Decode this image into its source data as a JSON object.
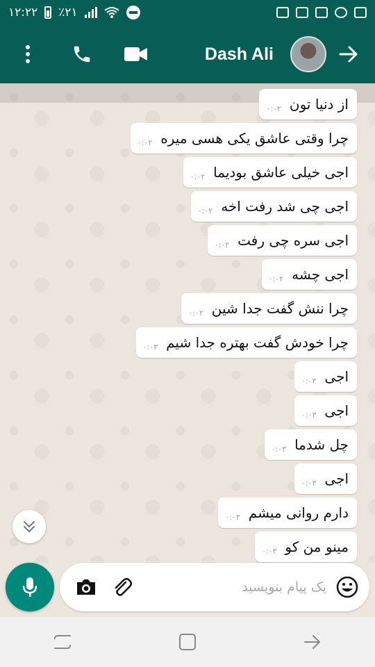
{
  "status_bar": {
    "time": "۱۲:۲۲",
    "battery": "٪۲۱"
  },
  "header": {
    "contact_name": "Dash Ali"
  },
  "messages": [
    {
      "text": "از دنیا تون",
      "time": "۰:۰۲"
    },
    {
      "text": "چرا وقتی عاشق یکی هسی میره",
      "time": "۰:۰۲"
    },
    {
      "text": "اجی خیلی عاشق بودیما",
      "time": "۰:۰۲"
    },
    {
      "text": "اجی چی شد رفت  اخه",
      "time": "۰:۰۲"
    },
    {
      "text": "اجی سره چی رفت",
      "time": "۰:۰۲"
    },
    {
      "text": "اجی چشه",
      "time": "۰:۰۲"
    },
    {
      "text": "چرا ننش گفت جدا شین",
      "time": "۰:۰۲"
    },
    {
      "text": "چرا خودش گفت بهتره جدا شیم",
      "time": "۰:۰۳"
    },
    {
      "text": "اجی",
      "time": "۰:۰۳"
    },
    {
      "text": "اجی",
      "time": "۰:۰۳"
    },
    {
      "text": "چل شدما",
      "time": "۰:۰۳"
    },
    {
      "text": "اجی",
      "time": "۰:۰۳"
    },
    {
      "text": "دارم روانی میشم",
      "time": "۰:۰۳"
    },
    {
      "text": "مینو من کو",
      "time": "۰:۰۳"
    }
  ],
  "composer": {
    "placeholder": "یک پیام بنویسید"
  },
  "colors": {
    "header": "#075e54",
    "mic_button": "#00897b",
    "chat_background": "#ece5dd",
    "bubble": "#ffffff"
  },
  "icons": {
    "status": [
      "gallery-icon",
      "notification-icon",
      "voicemail-icon",
      "chrome-icon",
      "instagram-icon",
      "wifi-icon",
      "signal-icon",
      "battery-icon",
      "dnd-icon"
    ],
    "header": [
      "more-vert-icon",
      "phone-icon",
      "video-call-icon",
      "avatar",
      "back-arrow-icon"
    ],
    "composer": [
      "mic-icon",
      "camera-icon",
      "attach-icon",
      "emoji-icon"
    ],
    "nav": [
      "recents-icon",
      "home-icon",
      "back-icon"
    ]
  }
}
